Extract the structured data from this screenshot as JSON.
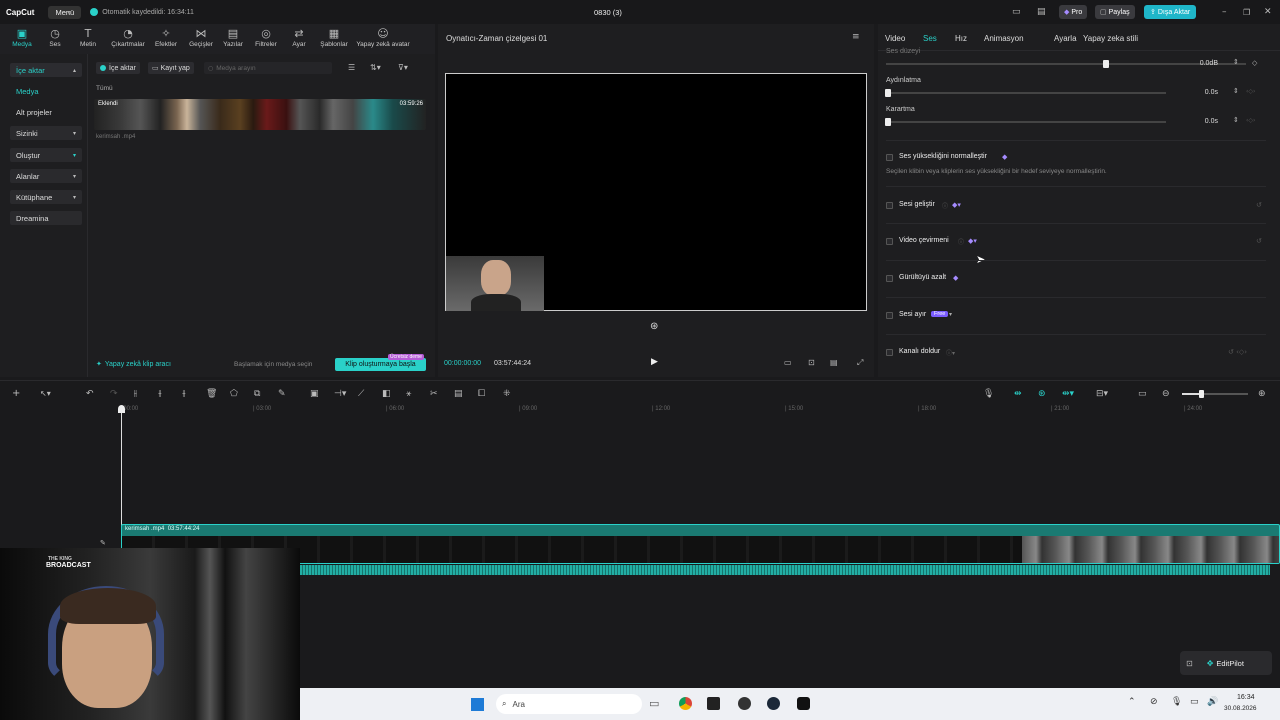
{
  "app": {
    "logo": "CapCut",
    "menu": "Menü",
    "autosave": "Otomatik kaydedildi: 16:34:11",
    "title": "0830 (3)",
    "pro": "Pro",
    "share": "Paylaş",
    "export": "Dışa Aktar"
  },
  "toolbar": [
    {
      "label": "Medya",
      "icon": "▣"
    },
    {
      "label": "Ses",
      "icon": "◷"
    },
    {
      "label": "Metin",
      "icon": "T"
    },
    {
      "label": "Çıkartmalar",
      "icon": "◔"
    },
    {
      "label": "Efektler",
      "icon": "✧"
    },
    {
      "label": "Geçişler",
      "icon": "⋈"
    },
    {
      "label": "Yazılar",
      "icon": "▤"
    },
    {
      "label": "Filtreler",
      "icon": "◎"
    },
    {
      "label": "Ayar",
      "icon": "⇄"
    },
    {
      "label": "Şablonlar",
      "icon": "▦"
    },
    {
      "label": "Yapay zekâ avatar",
      "icon": "☺"
    }
  ],
  "leftnav": {
    "import": "İçe aktar",
    "media": "Medya",
    "subprojects": "Alt projeler",
    "yours": "Sizinki",
    "create": "Oluştur",
    "spaces": "Alanlar",
    "library": "Kütüphane",
    "dreamina": "Dreamina"
  },
  "media": {
    "import_btn": "İçe aktar",
    "record_btn": "Kayıt yap",
    "search_ph": "Medya arayın",
    "filter_all": "Tümü",
    "added": "Eklendi",
    "duration": "03:59:26",
    "filename": "kerimsah .mp4",
    "ai_clip": "Yapay zekâ klip aracı",
    "start_hint": "Başlamak için medya seçin",
    "start_btn": "Klip oluşturmaya başla",
    "free_badge": "Ücretsiz deme"
  },
  "player": {
    "title": "Oynatıcı-Zaman çizelgesi 01",
    "time_cur": "00:00:00:00",
    "time_total": "03:57:44:24"
  },
  "props": {
    "tabs": [
      "Video",
      "Ses",
      "Hız",
      "Animasyon",
      "Ayarla",
      "Yapay zeka stili"
    ],
    "active_tab": "Ses",
    "volume_label": "Ses düzeyi",
    "volume_value": "0.0dB",
    "fadein_label": "Aydınlatma",
    "fadein_value": "0.0s",
    "fadeout_label": "Karartma",
    "fadeout_value": "0.0s",
    "normalize_label": "Ses yüksekliğini normalleştir",
    "normalize_desc": "Seçilen klibin veya kliplerin ses yüksekliğini bir hedef seviyeye normalleştirin.",
    "enhance_label": "Sesi geliştir",
    "translate_label": "Video çevirmeni",
    "noise_label": "Gürültüyü azalt",
    "separate_label": "Sesi ayır",
    "free_tag": "Free",
    "channel_label": "Kanalı doldur"
  },
  "ruler": [
    "00:00",
    "03:00",
    "06:00",
    "09:00",
    "12:00",
    "15:00",
    "18:00",
    "21:00",
    "24:00"
  ],
  "track": {
    "label": "kerimsah .mp4",
    "duration": "03:57:44:24"
  },
  "webcam": {
    "brand_top": "THE KING",
    "brand": "BROADCAST"
  },
  "editpilot": "EditPilot",
  "taskbar": {
    "search": "Ara",
    "time": "16:34",
    "date": "30.08.2026"
  },
  "colors": {
    "accent": "#2ad1c9",
    "export": "#1fb6c9",
    "track": "#1a7a72",
    "pro": "#7a5cff"
  }
}
